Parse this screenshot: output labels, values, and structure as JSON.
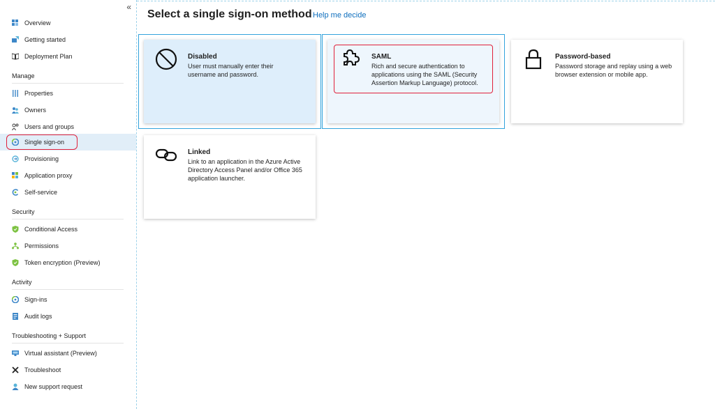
{
  "sidebar": {
    "collapse_glyph": "«",
    "items": [
      {
        "label": "Overview",
        "icon": "overview-icon"
      },
      {
        "label": "Getting started",
        "icon": "getting-started-icon"
      },
      {
        "label": "Deployment Plan",
        "icon": "book-icon"
      },
      {
        "label": "Properties",
        "icon": "properties-icon"
      },
      {
        "label": "Owners",
        "icon": "owners-icon"
      },
      {
        "label": "Users and groups",
        "icon": "users-groups-icon"
      },
      {
        "label": "Single sign-on",
        "icon": "sso-icon"
      },
      {
        "label": "Provisioning",
        "icon": "provisioning-icon"
      },
      {
        "label": "Application proxy",
        "icon": "app-proxy-icon"
      },
      {
        "label": "Self-service",
        "icon": "self-service-icon"
      },
      {
        "label": "Conditional Access",
        "icon": "shield-icon"
      },
      {
        "label": "Permissions",
        "icon": "permissions-icon"
      },
      {
        "label": "Token encryption (Preview)",
        "icon": "shield-icon"
      },
      {
        "label": "Sign-ins",
        "icon": "sign-ins-icon"
      },
      {
        "label": "Audit logs",
        "icon": "audit-logs-icon"
      },
      {
        "label": "Virtual assistant (Preview)",
        "icon": "virtual-assistant-icon"
      },
      {
        "label": "Troubleshoot",
        "icon": "troubleshoot-icon"
      },
      {
        "label": "New support request",
        "icon": "support-request-icon"
      }
    ],
    "sections": {
      "manage": "Manage",
      "security": "Security",
      "activity": "Activity",
      "troubleshooting": "Troubleshooting + Support"
    },
    "active_item": "Single sign-on"
  },
  "main": {
    "title": "Select a single sign-on method",
    "help_link": "Help me decide",
    "cards": [
      {
        "title": "Disabled",
        "desc": "User must manually enter their username and password.",
        "icon": "disabled-icon"
      },
      {
        "title": "SAML",
        "desc": "Rich and secure authentication to applications using the SAML (Security Assertion Markup Language) protocol.",
        "icon": "puzzle-icon"
      },
      {
        "title": "Password-based",
        "desc": "Password storage and replay using a web browser extension or mobile app.",
        "icon": "lock-icon"
      },
      {
        "title": "Linked",
        "desc": "Link to an application in the Azure Active Directory Access Panel and/or Office 365 application launcher.",
        "icon": "link-icon"
      }
    ]
  },
  "colors": {
    "accent_blue": "#0e6ebd",
    "selection_border": "#33a3dc",
    "selected_card_bg": "#deeefb",
    "hover_card_bg": "#eef6fd",
    "highlight_red": "#e0203a",
    "active_nav_bg": "#e1eef8"
  }
}
